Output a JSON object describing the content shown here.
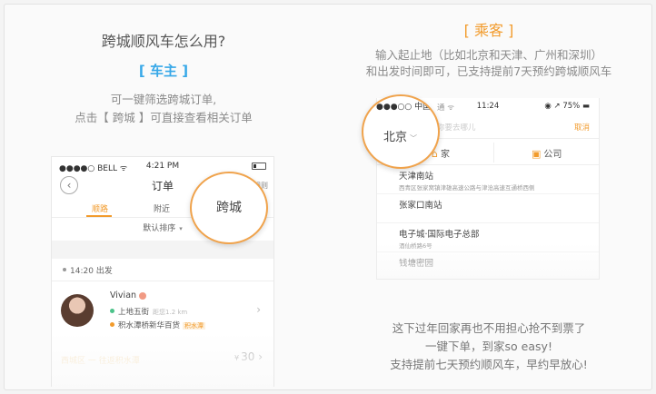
{
  "left": {
    "title": "跨城顺风车怎么用?",
    "role": "[ 车主 ]",
    "desc_line1": "可一键筛选跨城订单,",
    "desc_line2": "点击【 跨城 】可直接查看相关订单"
  },
  "phone_driver": {
    "status_left": "●●●●○ BELL ᯤ",
    "status_time": "4:21 PM",
    "back_icon": "‹",
    "nav_title": "订单",
    "nav_right": "规则",
    "tabs": [
      "顺路",
      "附近"
    ],
    "sort_label": "默认排序",
    "sort_arrow": "▾",
    "departure_time": "14:20 出发",
    "order": {
      "name": "Vivian",
      "from": "上地五街",
      "from_distance": "距您1.2 km",
      "to": "积水潭桥新华百货",
      "to_tag": "积水潭",
      "chevron": "›"
    },
    "next_label": "西城区 一 往返积水潭",
    "price_symbol": "¥",
    "price": "30",
    "price_suffix": "›",
    "circle_label": "跨城"
  },
  "right": {
    "role": "[ 乘客 ]",
    "desc_line1": "输入起止地（比如北京和天津、广州和深圳）",
    "desc_line2": "和出发时间即可，已支持提前7天预约跨城顺风车",
    "foot_line1": "这下过年回家再也不用担心抢不到票了",
    "foot_line2": "一键下单，到家so easy!",
    "foot_line3": "支持提前七天预约顺风车，早约早放心!"
  },
  "phone_passenger": {
    "status_carrier_partial": "通 ᯤ",
    "status_time": "11:24",
    "status_right": "◉ ↗ 75% ▬",
    "search_placeholder": "你要去哪儿",
    "cancel": "取消",
    "quick_home_icon": "⌂",
    "quick_home": "家",
    "quick_company_icon": "▣",
    "quick_company": "公司",
    "places": [
      {
        "name": "天津南站",
        "addr": "西青区张家窝镇津雄高速公路与津沧高速互通桥西侧"
      },
      {
        "name": "张家口南站",
        "addr": ""
      },
      {
        "name": "电子城·国际电子总部",
        "addr": "酒仙桥路6号"
      },
      {
        "name": "钱塘密园",
        "addr": ""
      }
    ],
    "circle_carrier": "●●●○○ 中国",
    "circle_city": "北京",
    "circle_chev": "﹀"
  },
  "colors": {
    "accent_orange": "#f29b2c",
    "driver_blue": "#37a8e8",
    "highlight_ring": "#f0a34c"
  }
}
